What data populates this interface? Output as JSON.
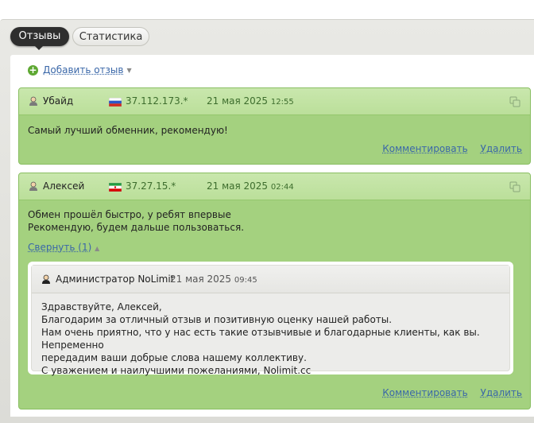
{
  "tabs": [
    {
      "label": "Отзывы",
      "active": true
    },
    {
      "label": "Статистика",
      "active": false
    }
  ],
  "add_review": {
    "label": "Добавить отзыв",
    "icon": "plus-circle-icon"
  },
  "reviews": [
    {
      "user": "Убайд",
      "flag": "russia-flag-icon",
      "ip": "37.112.173.*",
      "date": "21 мая 2025",
      "time": "12:55",
      "text": "Самый лучший обменник, рекомендую!",
      "comment_label": "Комментировать",
      "delete_label": "Удалить"
    },
    {
      "user": "Алексей",
      "flag": "iran-flag-icon",
      "ip": "37.27.15.*",
      "date": "21 мая 2025",
      "time": "02:44",
      "text_lines": [
        "Обмен прошёл быстро, у ребят впервые",
        "Рекомендую, будем дальше пользоваться."
      ],
      "collapse_label": "Свернуть (1)",
      "comment_label": "Комментировать",
      "delete_label": "Удалить",
      "reply": {
        "author": "Администратор NoLimit",
        "date": "21 мая 2025",
        "time": "09:45",
        "lines": [
          "Здравствуйте, Алексей,",
          "Благодарим за отличный отзыв и позитивную оценку нашей работы.",
          "Нам очень приятно, что у нас есть такие отзывчивые и благодарные клиенты, как вы. Непременно",
          "передадим ваши добрые слова нашему коллективу.",
          "С уважением и наилучшими пожеланиями, Nolimit.cc"
        ]
      }
    }
  ],
  "colors": {
    "accent_green": "#a4d17f",
    "link": "#3a67a8",
    "tab_active": "#2e2e2e"
  }
}
